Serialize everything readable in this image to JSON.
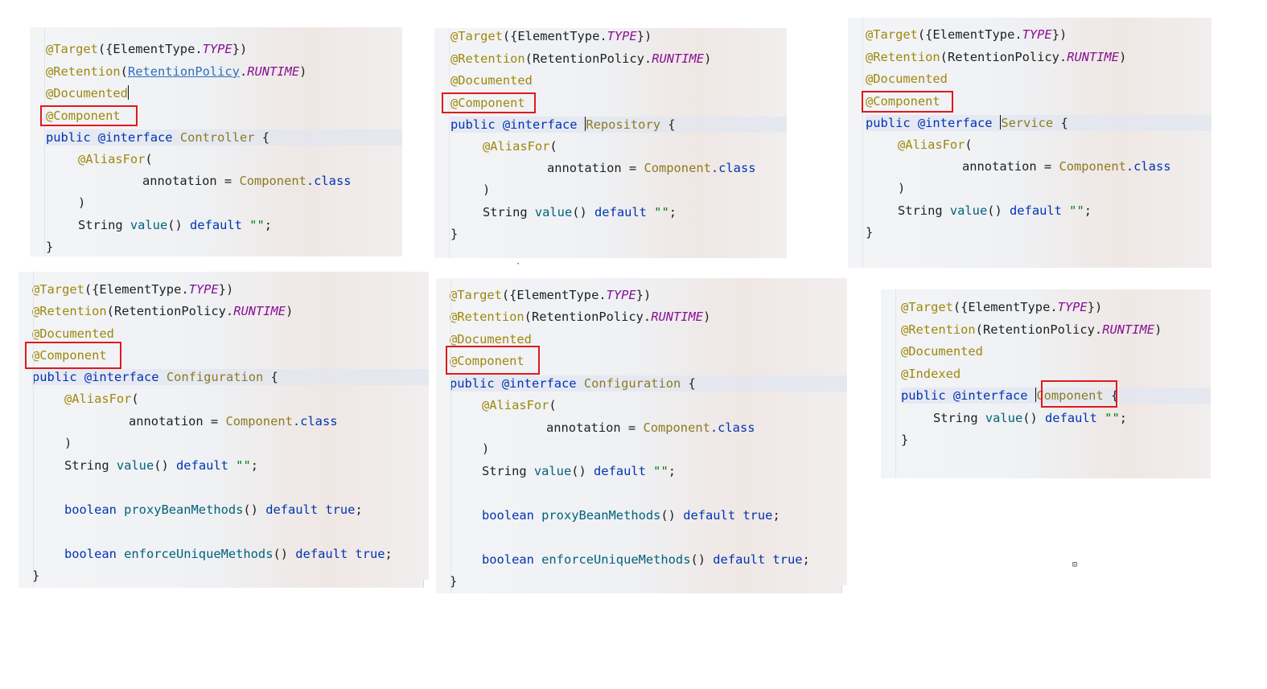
{
  "panels": {
    "controller": {
      "l1": {
        "a": "@Target",
        "b": "({ElementType.",
        "c": "TYPE",
        "d": "})"
      },
      "l2": {
        "a": "@Retention",
        "b": "(",
        "c": "RetentionPolicy",
        "d": ".",
        "e": "RUNTIME",
        "f": ")"
      },
      "l3": "@Documented",
      "l4": "@Component",
      "l5": {
        "a": "public ",
        "b": "@interface ",
        "c": "Controller",
        "d": " {"
      },
      "l6": {
        "a": "@AliasFor",
        "b": "("
      },
      "l7": {
        "a": "annotation = ",
        "b": "Component",
        "c": ".class"
      },
      "l8": ")",
      "l9": {
        "a": "String ",
        "b": "value",
        "c": "() ",
        "d": "default ",
        "e": "\"\"",
        "f": ";"
      },
      "l10": "}"
    },
    "repository": {
      "l1": {
        "a": "@Target",
        "b": "({ElementType.",
        "c": "TYPE",
        "d": "})"
      },
      "l2": {
        "a": "@Retention",
        "b": "(RetentionPolicy.",
        "c": "RUNTIME",
        "d": ")"
      },
      "l3": "@Documented",
      "l4": "@Component",
      "l5": {
        "a": "public ",
        "b": "@interface ",
        "c": "Repository",
        "d": " {"
      },
      "l6": {
        "a": "@AliasFor",
        "b": "("
      },
      "l7": {
        "a": "annotation = ",
        "b": "Component",
        "c": ".class"
      },
      "l8": ")",
      "l9": {
        "a": "String ",
        "b": "value",
        "c": "() ",
        "d": "default ",
        "e": "\"\"",
        "f": ";"
      },
      "l10": "}"
    },
    "service": {
      "l1": {
        "a": "@Target",
        "b": "({ElementType.",
        "c": "TYPE",
        "d": "})"
      },
      "l2": {
        "a": "@Retention",
        "b": "(RetentionPolicy.",
        "c": "RUNTIME",
        "d": ")"
      },
      "l3": "@Documented",
      "l4": "@Component",
      "l5": {
        "a": "public ",
        "b": "@interface ",
        "c": "Service",
        "d": " {"
      },
      "l6": {
        "a": "@AliasFor",
        "b": "("
      },
      "l7": {
        "a": "annotation = ",
        "b": "Component",
        "c": ".class"
      },
      "l8": ")",
      "l9": {
        "a": "String ",
        "b": "value",
        "c": "() ",
        "d": "default ",
        "e": "\"\"",
        "f": ";"
      },
      "l10": "}"
    },
    "configuration_a": {
      "l1": {
        "a": "@Target",
        "b": "({ElementType.",
        "c": "TYPE",
        "d": "})"
      },
      "l2": {
        "a": "@Retention",
        "b": "(RetentionPolicy.",
        "c": "RUNTIME",
        "d": ")"
      },
      "l3": "@Documented",
      "l4": "@Component",
      "l5": {
        "a": "public ",
        "b": "@interface ",
        "c": "Configuration",
        "d": " {"
      },
      "l6": {
        "a": "@AliasFor",
        "b": "("
      },
      "l7": {
        "a": "annotation = ",
        "b": "Component",
        "c": ".class"
      },
      "l8": ")",
      "l9": {
        "a": "String ",
        "b": "value",
        "c": "() ",
        "d": "default ",
        "e": "\"\"",
        "f": ";"
      },
      "l10": {
        "a": "boolean ",
        "b": "proxyBeanMethods",
        "c": "() ",
        "d": "default ",
        "e": "true",
        "f": ";"
      },
      "l11": {
        "a": "boolean ",
        "b": "enforceUniqueMethods",
        "c": "() ",
        "d": "default ",
        "e": "true",
        "f": ";"
      },
      "l12": "}"
    },
    "configuration_b": {
      "l1": {
        "a": "@Target",
        "b": "({ElementType.",
        "c": "TYPE",
        "d": "})"
      },
      "l2": {
        "a": "@Retention",
        "b": "(RetentionPolicy.",
        "c": "RUNTIME",
        "d": ")"
      },
      "l3": "@Documented",
      "l4": "@Component",
      "l5": {
        "a": "public ",
        "b": "@interface ",
        "c": "Configuration",
        "d": " {"
      },
      "l6": {
        "a": "@AliasFor",
        "b": "("
      },
      "l7": {
        "a": "annotation = ",
        "b": "Component",
        "c": ".class"
      },
      "l8": ")",
      "l9": {
        "a": "String ",
        "b": "value",
        "c": "() ",
        "d": "default ",
        "e": "\"\"",
        "f": ";"
      },
      "l10": {
        "a": "boolean ",
        "b": "proxyBeanMethods",
        "c": "() ",
        "d": "default ",
        "e": "true",
        "f": ";"
      },
      "l11": {
        "a": "boolean ",
        "b": "enforceUniqueMethods",
        "c": "() ",
        "d": "default ",
        "e": "true",
        "f": ";"
      },
      "l12": "}"
    },
    "component": {
      "l1": {
        "a": "@Target",
        "b": "({ElementType.",
        "c": "TYPE",
        "d": "})"
      },
      "l2": {
        "a": "@Retention",
        "b": "(RetentionPolicy.",
        "c": "RUNTIME",
        "d": ")"
      },
      "l3": "@Documented",
      "l4": "@Indexed",
      "l5": {
        "a": "public ",
        "b": "@interface ",
        "c": "Component",
        "d": " {"
      },
      "l6": {
        "a": "String ",
        "b": "value",
        "c": "() ",
        "d": "default ",
        "e": "\"\"",
        "f": ";"
      },
      "l7": "}"
    }
  },
  "colors": {
    "annotation": "#9e880d",
    "keyword": "#0033b3",
    "class_name": "#8c7a1f",
    "constant": "#871094",
    "method": "#00627a",
    "string": "#067d17",
    "highlight_box": "#e0191c"
  },
  "icons": {
    "corner_marker": "small-square-icon"
  }
}
